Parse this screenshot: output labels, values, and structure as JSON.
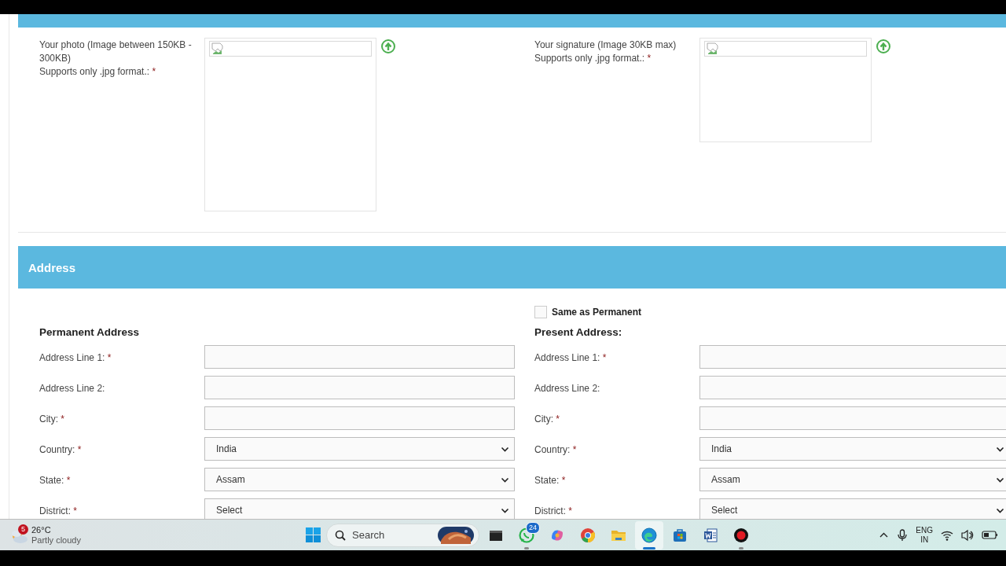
{
  "upload_section": {
    "uploads": [
      {
        "label": "Your photo (Image between 150KB - 300KB)",
        "note": "Supports only .jpg format.:",
        "required_mark": "*"
      },
      {
        "kind": "signature",
        "label": "Your signature (Image 30KB max)",
        "note": "Supports only .jpg format.:",
        "required_mark": "*"
      }
    ]
  },
  "address": {
    "title": "Address",
    "same_as_permanent": {
      "label": "Same as Permanent",
      "checked": false
    },
    "columns": [
      {
        "heading": "Permanent Address",
        "fields": [
          {
            "kind": "text",
            "label": "Address Line 1:",
            "required_mark": "*"
          },
          {
            "kind": "text",
            "label": "Address Line 2:"
          },
          {
            "kind": "text",
            "label": "City:",
            "required_mark": "*"
          },
          {
            "kind": "select",
            "label": "Country:",
            "required_mark": "*",
            "value": "India"
          },
          {
            "kind": "select",
            "label": "State:",
            "required_mark": "*",
            "value": "Assam"
          },
          {
            "kind": "select",
            "label": "District:",
            "required_mark": "*",
            "value": "Select"
          }
        ]
      },
      {
        "heading": "Present Address:",
        "fields": [
          {
            "kind": "text",
            "label": "Address Line 1:",
            "required_mark": "*"
          },
          {
            "kind": "text",
            "label": "Address Line 2:"
          },
          {
            "kind": "text",
            "label": "City:",
            "required_mark": "*"
          },
          {
            "kind": "select",
            "label": "Country:",
            "required_mark": "*",
            "value": "India"
          },
          {
            "kind": "select",
            "label": "State:",
            "required_mark": "*",
            "value": "Assam"
          },
          {
            "kind": "select",
            "label": "District:",
            "required_mark": "*",
            "value": "Select"
          }
        ]
      }
    ]
  },
  "taskbar": {
    "weather": {
      "badge": "5",
      "temperature": "26°C",
      "condition": "Partly cloudy"
    },
    "search": {
      "label": "Search"
    },
    "apps": [
      {
        "kind": "terminal",
        "running": false,
        "selected": false
      },
      {
        "kind": "chat",
        "badge": "24",
        "running": true,
        "selected": false
      },
      {
        "kind": "swirl",
        "running": false,
        "selected": false
      },
      {
        "kind": "chrome",
        "running": false,
        "selected": false
      },
      {
        "kind": "folder",
        "running": false,
        "selected": false
      },
      {
        "kind": "edge",
        "running": true,
        "selected": true
      },
      {
        "kind": "store",
        "running": false,
        "selected": false
      },
      {
        "kind": "word",
        "running": false,
        "selected": false
      },
      {
        "kind": "record",
        "running": true,
        "selected": false
      }
    ],
    "tray": {
      "language": "ENG",
      "region": "IN"
    }
  }
}
